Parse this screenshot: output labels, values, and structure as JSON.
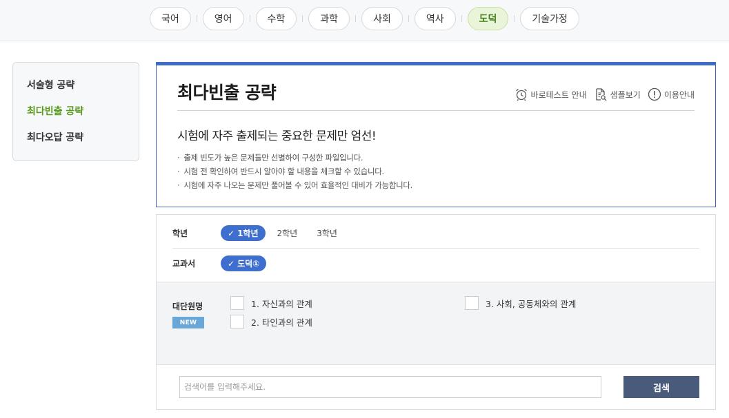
{
  "subjects": [
    {
      "label": "국어"
    },
    {
      "label": "영어"
    },
    {
      "label": "수학"
    },
    {
      "label": "과학"
    },
    {
      "label": "사회"
    },
    {
      "label": "역사"
    },
    {
      "label": "도덕",
      "active": true
    },
    {
      "label": "기술가정"
    }
  ],
  "sidebar": {
    "items": [
      {
        "label": "서술형 공략"
      },
      {
        "label": "최다빈출 공략",
        "active": true
      },
      {
        "label": "최다오답 공략"
      }
    ]
  },
  "info": {
    "title": "최다빈출 공략",
    "links": {
      "betatest": "바로테스트 안내",
      "sample": "샘플보기",
      "usage": "이용안내"
    },
    "subtitle": "시험에 자주 출제되는 중요한 문제만 엄선!",
    "bullets": [
      "출제 빈도가 높은 문제들만 선별하여 구성한 파일입니다.",
      "시험 전 확인하여 반드시 알아야 할 내용을 체크할 수 있습니다.",
      "시험에 자주 나오는 문제만 풀어볼 수 있어 효율적인 대비가 가능합니다."
    ]
  },
  "filter": {
    "grade": {
      "label": "학년",
      "selected": "1학년",
      "options": [
        "2학년",
        "3학년"
      ]
    },
    "textbook": {
      "label": "교과서",
      "selected": "도덕①"
    },
    "units": {
      "label": "대단원명",
      "badge": "NEW",
      "items": [
        "1. 자신과의 관계",
        "2. 타인과의 관계",
        "3. 사회, 공동체와의 관계"
      ]
    },
    "search": {
      "placeholder": "검색어를 입력해주세요.",
      "button": "검색"
    }
  },
  "colors": {
    "accent_blue": "#3c6cc8",
    "active_green": "#5a9a1d",
    "search_button": "#4a5a7a",
    "new_badge": "#6aa7d9"
  }
}
